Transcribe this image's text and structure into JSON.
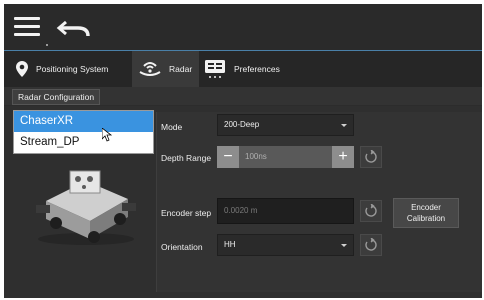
{
  "toolbar": {
    "menu_icon": "hamburger-icon",
    "undo_icon": "undo-icon"
  },
  "tabs": [
    {
      "label": "Positioning System",
      "icon": "location-pin-icon"
    },
    {
      "label": "Radar",
      "icon": "radar-icon"
    },
    {
      "label": "Preferences",
      "icon": "preferences-icon"
    }
  ],
  "subtab": {
    "label": "Radar Configuration"
  },
  "device_dropdown": {
    "items": [
      "ChaserXR",
      "Stream_DP"
    ],
    "selected": "ChaserXR"
  },
  "settings": {
    "mode": {
      "label": "Mode",
      "value": "200-Deep"
    },
    "depth_range": {
      "label": "Depth Range",
      "value": "100ns"
    },
    "encoder_step": {
      "label": "Encoder step",
      "value": "0.0020 m"
    },
    "encoder_button_line1": "Encoder",
    "encoder_button_line2": "Calibration",
    "orientation": {
      "label": "Orientation",
      "value": "HH"
    }
  }
}
